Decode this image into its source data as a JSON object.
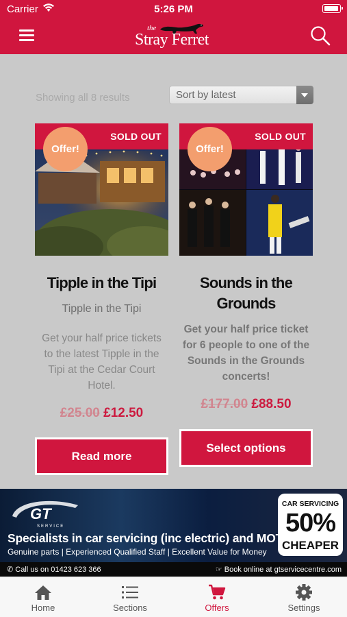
{
  "status_bar": {
    "carrier": "Carrier",
    "time": "5:26 PM"
  },
  "header": {
    "logo_small": "the",
    "logo_text": "Stray Ferret",
    "menu_icon": "hamburger-menu-icon",
    "search_icon": "search-icon",
    "brand_color": "#d0163e"
  },
  "listing": {
    "results_text": "Showing all 8 results",
    "sort_selected": "Sort by latest"
  },
  "products": [
    {
      "badge": "SOLD OUT",
      "offer": "Offer!",
      "title": "Tipple in the Tipi",
      "subtitle": "Tipple in the Tipi",
      "description": "Get your half price tickets to the latest Tipple in the Tipi at the Cedar Court Hotel.",
      "old_price": "£25.00",
      "new_price": "£12.50",
      "button": "Read more"
    },
    {
      "badge": "SOLD OUT",
      "offer": "Offer!",
      "title": "Sounds in the Grounds",
      "description": "Get your half price ticket for 6 people to one of the Sounds in the Grounds concerts!",
      "old_price": "£177.00",
      "new_price": "£88.50",
      "button": "Select options"
    }
  ],
  "ad": {
    "logo": "GT",
    "logo_sub": "SERVICE",
    "headline": "Specialists in car servicing (inc electric) and MOT",
    "subline": "Genuine parts | Experienced Qualified Staff | Excellent Value for Money",
    "phone": "Call us on 01423 623 366",
    "online": "Book online at gtservicecentre.com",
    "badge_top": "CAR SERVICING",
    "badge_big": "50%",
    "badge_bottom": "CHEAPER"
  },
  "tabs": [
    {
      "label": "Home",
      "icon": "home-icon",
      "active": false
    },
    {
      "label": "Sections",
      "icon": "list-icon",
      "active": false
    },
    {
      "label": "Offers",
      "icon": "cart-icon",
      "active": true
    },
    {
      "label": "Settings",
      "icon": "gear-icon",
      "active": false
    }
  ]
}
